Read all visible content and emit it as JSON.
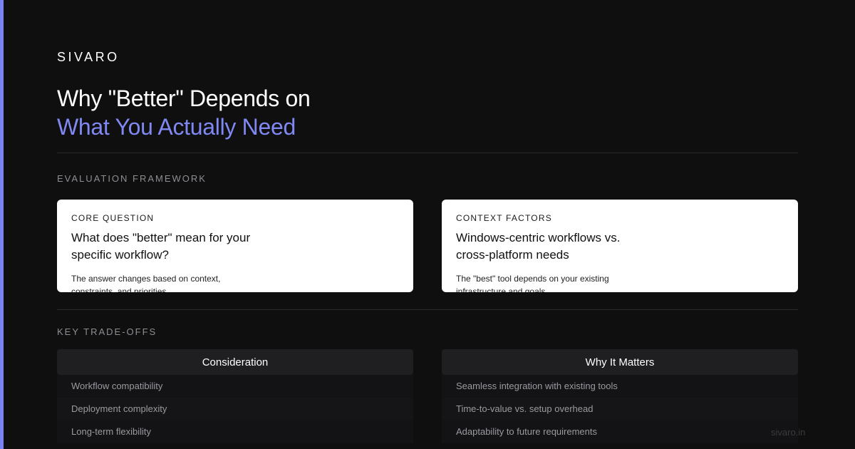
{
  "brand": "SIVARO",
  "title": {
    "line1": "Why \"Better\" Depends on",
    "line2": "What You Actually Need"
  },
  "sections": {
    "framework_label": "EVALUATION FRAMEWORK",
    "tradeoffs_label": "KEY TRADE-OFFS"
  },
  "cards": [
    {
      "kicker": "CORE QUESTION",
      "heading": "What does \"better\" mean for your specific workflow?",
      "body": "The answer changes based on context, constraints, and priorities."
    },
    {
      "kicker": "CONTEXT FACTORS",
      "heading": "Windows-centric workflows vs. cross-platform needs",
      "body": "The \"best\" tool depends on your existing infrastructure and goals."
    }
  ],
  "tradeoffs": {
    "left": {
      "header": "Consideration",
      "rows": [
        "Workflow compatibility",
        "Deployment complexity",
        "Long-term flexibility"
      ]
    },
    "right": {
      "header": "Why It Matters",
      "rows": [
        "Seamless integration with existing tools",
        "Time-to-value vs. setup overhead",
        "Adaptability to future requirements"
      ]
    }
  },
  "footer": {
    "url": "sivaro.in"
  },
  "colors": {
    "accent": "#7b82f5",
    "background": "#0f0f10",
    "card": "#ffffff"
  }
}
